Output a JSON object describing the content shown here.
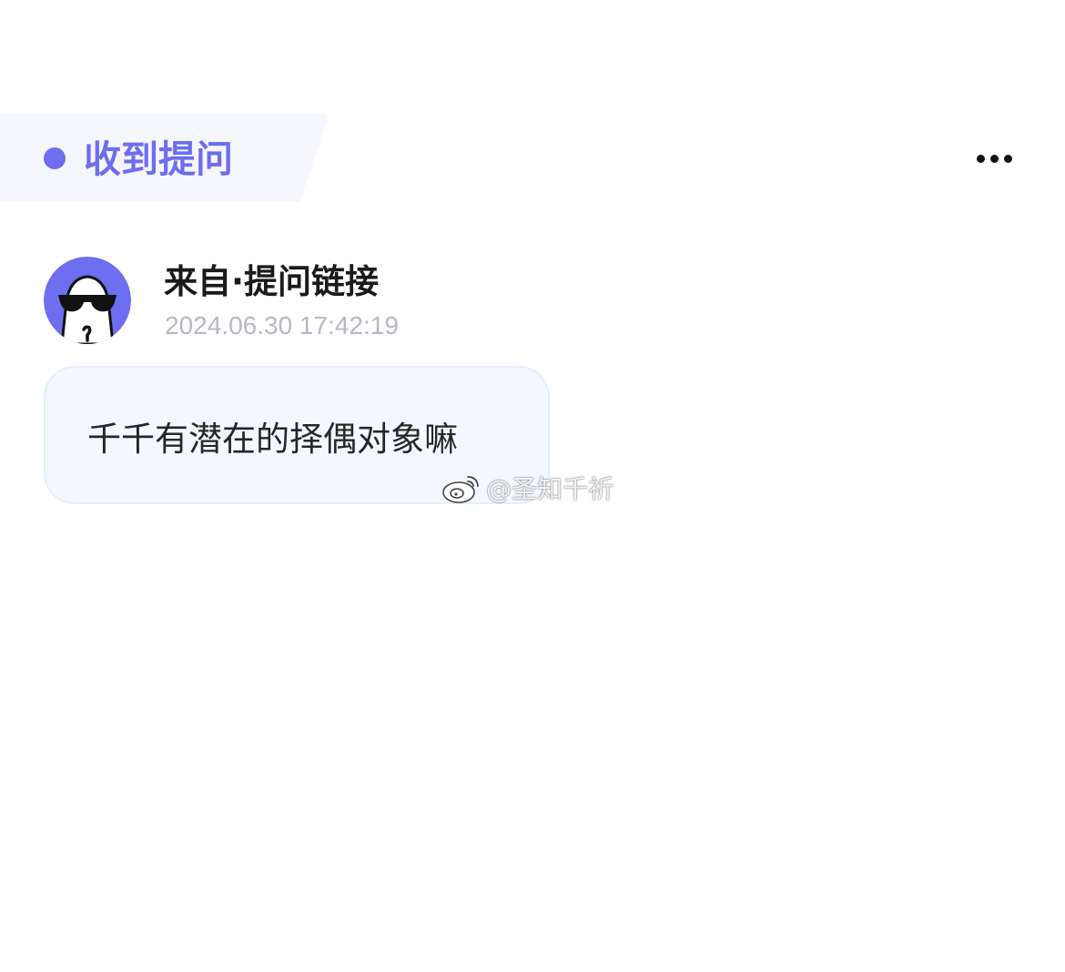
{
  "header": {
    "tag_label": "收到提问",
    "more_icon": "more-horizontal-icon",
    "accent_color": "#6d6ef0"
  },
  "question": {
    "avatar_icon": "anonymous-sunglasses-avatar",
    "sender": "来自·提问链接",
    "timestamp": "2024.06.30 17:42:19",
    "text": "千千有潜在的择偶对象嘛"
  },
  "watermark": {
    "icon": "weibo-logo-icon",
    "text": "@圣知千祈"
  }
}
